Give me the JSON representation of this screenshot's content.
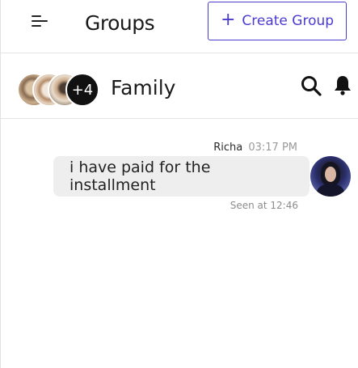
{
  "header": {
    "title": "Groups",
    "create_button": {
      "icon": "plus-icon",
      "label": "Create Group"
    },
    "menu_icon": "menu-icon"
  },
  "group": {
    "name": "Family",
    "member_avatars": [
      "member-avatar-1",
      "member-avatar-2",
      "member-avatar-3"
    ],
    "extra_members": "+4",
    "actions": {
      "search_icon": "search-icon",
      "bell_icon": "bell-icon"
    }
  },
  "messages": [
    {
      "sender": "Richa",
      "time": "03:17 PM",
      "text": "i have paid for the installment",
      "status": "Seen at 12:46"
    }
  ],
  "colors": {
    "accent": "#4a3bd1",
    "bubble": "#eeeeee",
    "muted": "#9a9a9a"
  }
}
